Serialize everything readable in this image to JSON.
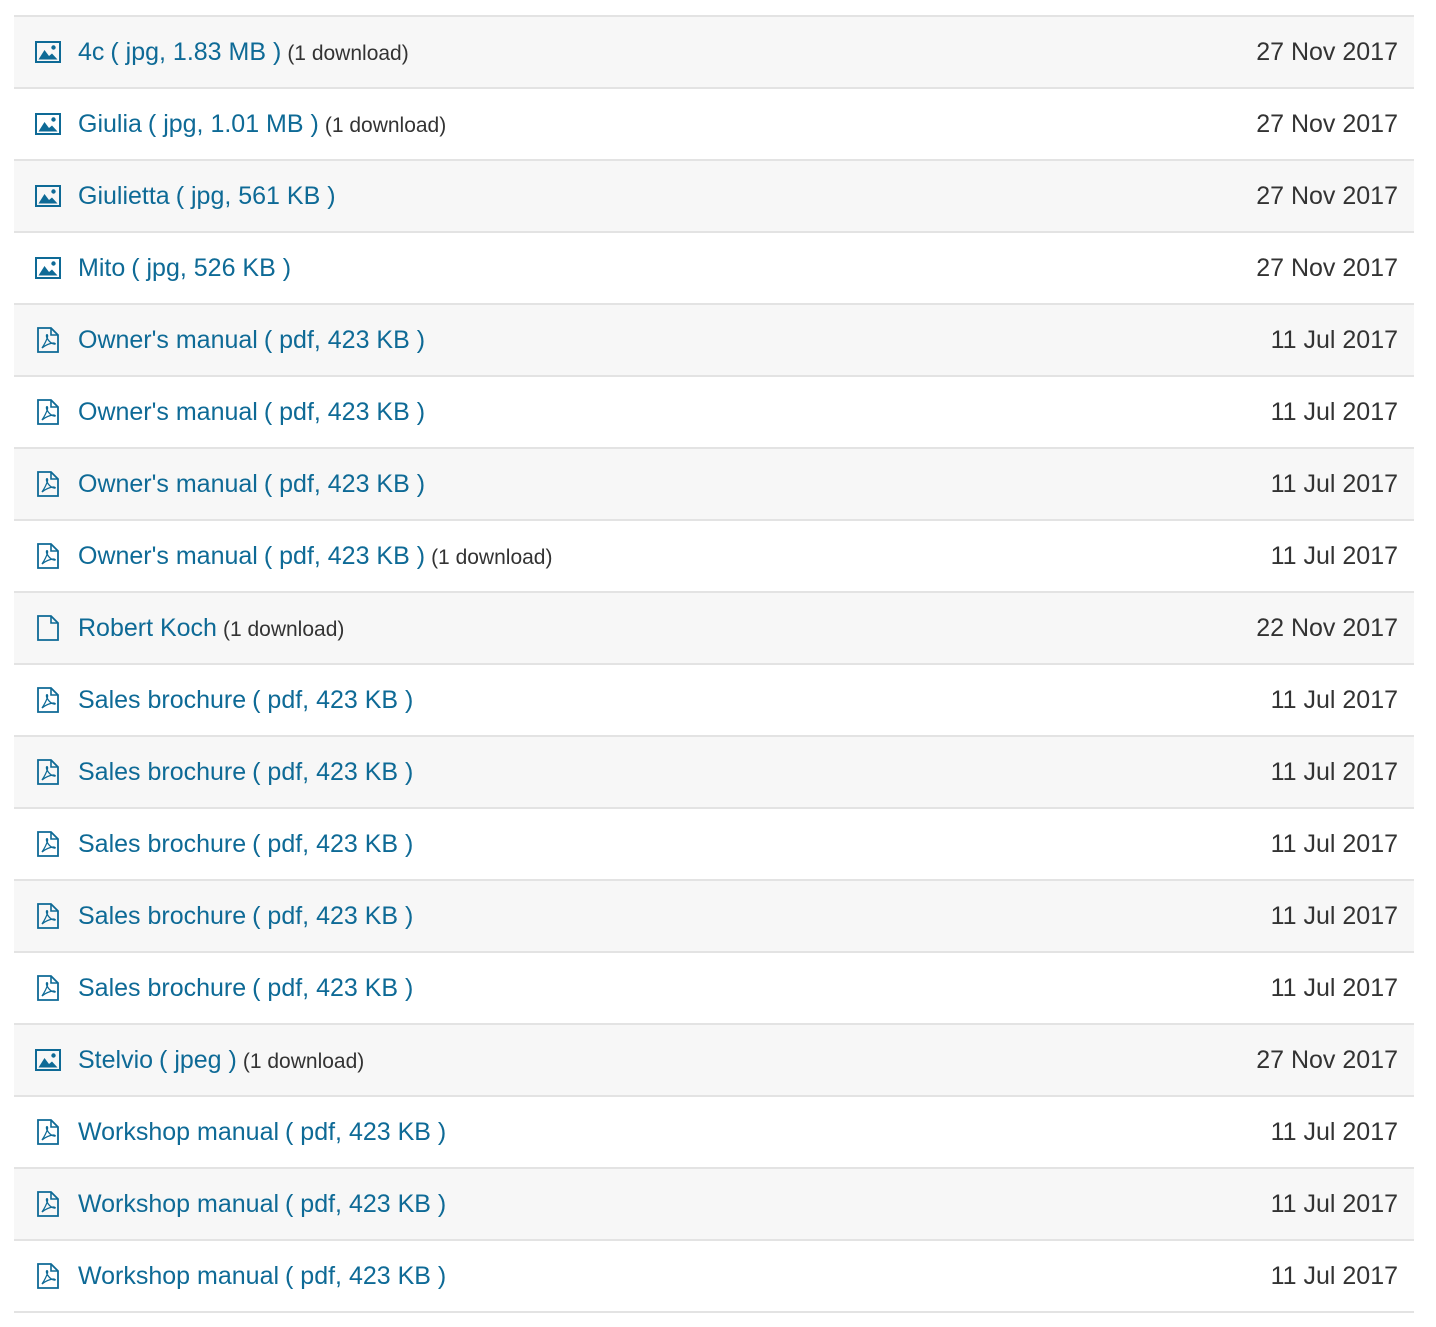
{
  "colors": {
    "link": "#0e6a96",
    "text": "#333333",
    "row_alt": "#f7f7f7",
    "border": "#e3e3e3"
  },
  "files": [
    {
      "icon": "image-icon",
      "name": "4c",
      "meta": "( jpg, 1.83 MB )",
      "downloads": "(1 download)",
      "date": "27 Nov 2017"
    },
    {
      "icon": "image-icon",
      "name": "Giulia",
      "meta": "( jpg, 1.01 MB )",
      "downloads": "(1 download)",
      "date": "27 Nov 2017"
    },
    {
      "icon": "image-icon",
      "name": "Giulietta",
      "meta": "( jpg, 561 KB )",
      "downloads": "",
      "date": "27 Nov 2017"
    },
    {
      "icon": "image-icon",
      "name": "Mito",
      "meta": "( jpg, 526 KB )",
      "downloads": "",
      "date": "27 Nov 2017"
    },
    {
      "icon": "pdf-icon",
      "name": "Owner's manual",
      "meta": "( pdf, 423 KB )",
      "downloads": "",
      "date": "11 Jul 2017"
    },
    {
      "icon": "pdf-icon",
      "name": "Owner's manual",
      "meta": "( pdf, 423 KB )",
      "downloads": "",
      "date": "11 Jul 2017"
    },
    {
      "icon": "pdf-icon",
      "name": "Owner's manual",
      "meta": "( pdf, 423 KB )",
      "downloads": "",
      "date": "11 Jul 2017"
    },
    {
      "icon": "pdf-icon",
      "name": "Owner's manual",
      "meta": "( pdf, 423 KB )",
      "downloads": "(1 download)",
      "date": "11 Jul 2017"
    },
    {
      "icon": "file-icon",
      "name": "Robert Koch",
      "meta": "",
      "downloads": "(1 download)",
      "date": "22 Nov 2017"
    },
    {
      "icon": "pdf-icon",
      "name": "Sales brochure",
      "meta": "( pdf, 423 KB )",
      "downloads": "",
      "date": "11 Jul 2017"
    },
    {
      "icon": "pdf-icon",
      "name": "Sales brochure",
      "meta": "( pdf, 423 KB )",
      "downloads": "",
      "date": "11 Jul 2017"
    },
    {
      "icon": "pdf-icon",
      "name": "Sales brochure",
      "meta": "( pdf, 423 KB )",
      "downloads": "",
      "date": "11 Jul 2017"
    },
    {
      "icon": "pdf-icon",
      "name": "Sales brochure",
      "meta": "( pdf, 423 KB )",
      "downloads": "",
      "date": "11 Jul 2017"
    },
    {
      "icon": "pdf-icon",
      "name": "Sales brochure",
      "meta": "( pdf, 423 KB )",
      "downloads": "",
      "date": "11 Jul 2017"
    },
    {
      "icon": "image-icon",
      "name": "Stelvio",
      "meta": "( jpeg )",
      "downloads": "(1 download)",
      "date": "27 Nov 2017"
    },
    {
      "icon": "pdf-icon",
      "name": "Workshop manual",
      "meta": "( pdf, 423 KB )",
      "downloads": "",
      "date": "11 Jul 2017"
    },
    {
      "icon": "pdf-icon",
      "name": "Workshop manual",
      "meta": "( pdf, 423 KB )",
      "downloads": "",
      "date": "11 Jul 2017"
    },
    {
      "icon": "pdf-icon",
      "name": "Workshop manual",
      "meta": "( pdf, 423 KB )",
      "downloads": "",
      "date": "11 Jul 2017"
    }
  ]
}
